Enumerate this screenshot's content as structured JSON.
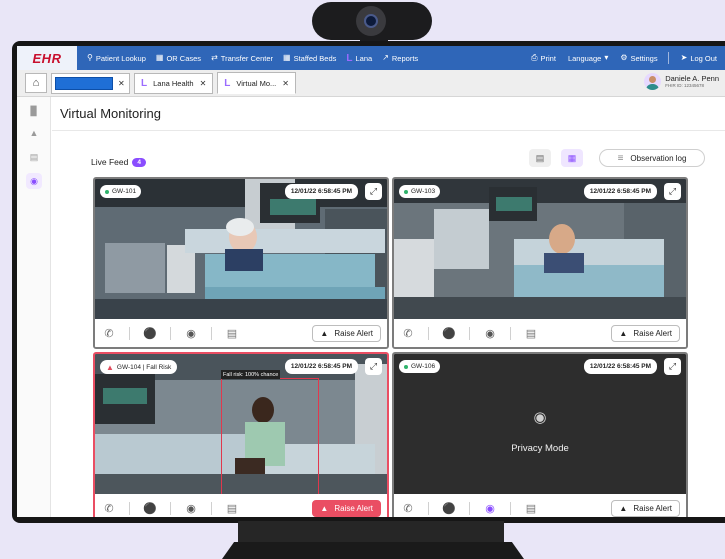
{
  "nav": {
    "logo": "EHR",
    "links": [
      {
        "icon": "search-icon",
        "label": "Patient Lookup"
      },
      {
        "icon": "calendar-icon",
        "label": "OR Cases"
      },
      {
        "icon": "transfer-icon",
        "label": "Transfer Center"
      },
      {
        "icon": "bed-icon",
        "label": "Staffed Beds"
      },
      {
        "icon": "lana-logo-icon",
        "label": "Lana"
      },
      {
        "icon": "chart-icon",
        "label": "Reports"
      }
    ],
    "right": {
      "print": "Print",
      "language": "Language",
      "settings": "Settings",
      "logout": "Log Out"
    }
  },
  "tabs": {
    "items": [
      {
        "label": "",
        "redacted": true
      },
      {
        "label": "Lana Health"
      },
      {
        "label": "Virtual Mo...",
        "active": true
      }
    ]
  },
  "user": {
    "name": "Daniele A. Penn",
    "id": "FHIR ID: 12345678"
  },
  "page": {
    "title": "Virtual Monitoring",
    "live_feed_label": "Live Feed",
    "live_feed_count": "4",
    "observation_log": "Observation log"
  },
  "feeds": [
    {
      "room": "GW-101",
      "timestamp": "12/01/22 6:58:45 PM",
      "alert": false,
      "privacy": false,
      "raise_label": "Raise Alert"
    },
    {
      "room": "GW-103",
      "timestamp": "12/01/22 6:58:45 PM",
      "alert": false,
      "privacy": false,
      "raise_label": "Raise Alert"
    },
    {
      "room": "GW-104 | Fall Risk",
      "timestamp": "12/01/22 6:58:45 PM",
      "alert": true,
      "privacy": false,
      "raise_label": "Raise Alert",
      "detection_label": "Fall risk: 100% chance"
    },
    {
      "room": "GW-106",
      "timestamp": "12/01/22 6:58:45 PM",
      "alert": false,
      "privacy": true,
      "privacy_label": "Privacy Mode",
      "raise_label": "Raise Alert"
    }
  ],
  "colors": {
    "nav_blue": "#2f66b8",
    "accent_purple": "#8a4dff",
    "alert_red": "#ea4e63"
  }
}
